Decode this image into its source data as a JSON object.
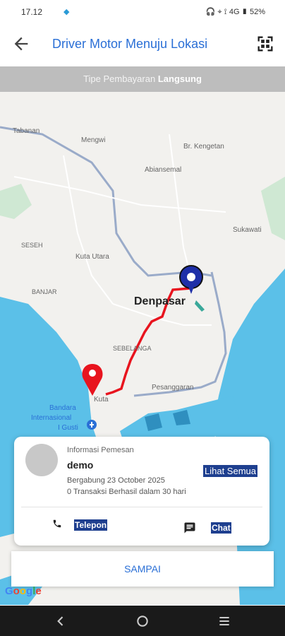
{
  "status_bar": {
    "time": "17.12",
    "right": "🎧 ⌖ ⟟ 4G ▮ 52%"
  },
  "header": {
    "title": "Driver Motor Menuju Lokasi"
  },
  "payment_bar": {
    "prefix": "Tipe Pembayaran",
    "type": "Langsung"
  },
  "map_labels": {
    "tabanan": "Tabanan",
    "mengwi": "Mengwi",
    "kengetan": "Br. Kengetan",
    "abiansemal": "Abiansemal",
    "sukawati": "Sukawati",
    "seseh": "SESEH",
    "kuta_utara": "Kuta Utara",
    "banjar": "BANJAR",
    "denpasar": "Denpasar",
    "sebelanga": "SEBELANGA",
    "pesanggaran": "Pesanggaran",
    "kuta": "Kuta",
    "airport_1": "Bandara",
    "airport_2": "Internasional",
    "airport_3": "I Gusti"
  },
  "card": {
    "info_label": "Informasi Pemesan",
    "name": "demo",
    "joined": "Bergabung 23 October 2025",
    "transactions": "0 Transaksi Berhasil dalam 30 hari",
    "see_all": "Lihat Semua",
    "call": "Telepon",
    "chat": "Chat"
  },
  "arrive_button": "SAMPAI",
  "google": "Google",
  "colors": {
    "accent": "#2a6fd6",
    "route": "#e8141e",
    "water": "#5bc0e8"
  }
}
